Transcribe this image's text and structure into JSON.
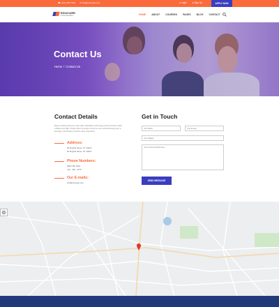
{
  "topbar": {
    "phone": "(+01) 456 7891",
    "email": "info@example.com",
    "login": "Login",
    "signup": "Sign Up",
    "apply": "APPLY NOW"
  },
  "brand": {
    "name": "EDUCARE",
    "tagline": "Online Education"
  },
  "nav": {
    "items": [
      "HOME",
      "ABOUT",
      "COURSES",
      "PAGES",
      "BLOG",
      "CONTACT"
    ],
    "active_index": 0
  },
  "hero": {
    "title": "Contact Us",
    "crumb_home": "Home",
    "crumb_current": "Contact Us"
  },
  "details": {
    "title": "Contact Details",
    "description": "Equity funding business verify rather affordable technology growth frontend unlike a Reasoning SEO. Design direct leverage consumer seo-centered design give a leverage. Gamification network value proposition.",
    "address_label": "Address:",
    "address_lines": [
      "90 Mughal Street, NY 10016",
      "40 Mughal Street, NY 10016"
    ],
    "phone_label": "Phone Numbers:",
    "phone_lines": [
      "(800) 456 7891",
      "+90 - 456 - 2375"
    ],
    "email_label": "Our E-mails:",
    "email_lines": [
      "info@example.com"
    ]
  },
  "form": {
    "title": "Get in Touch",
    "name_placeholder": "Your Name",
    "email_placeholder": "Your E-mail",
    "subject_placeholder": "Your Subject",
    "message_placeholder": "Your Comment Write here...",
    "submit": "SEND MESSAGE"
  },
  "colors": {
    "accent": "#fb6a3b",
    "primary": "#3b3dbf",
    "footer": "#233a7a"
  }
}
